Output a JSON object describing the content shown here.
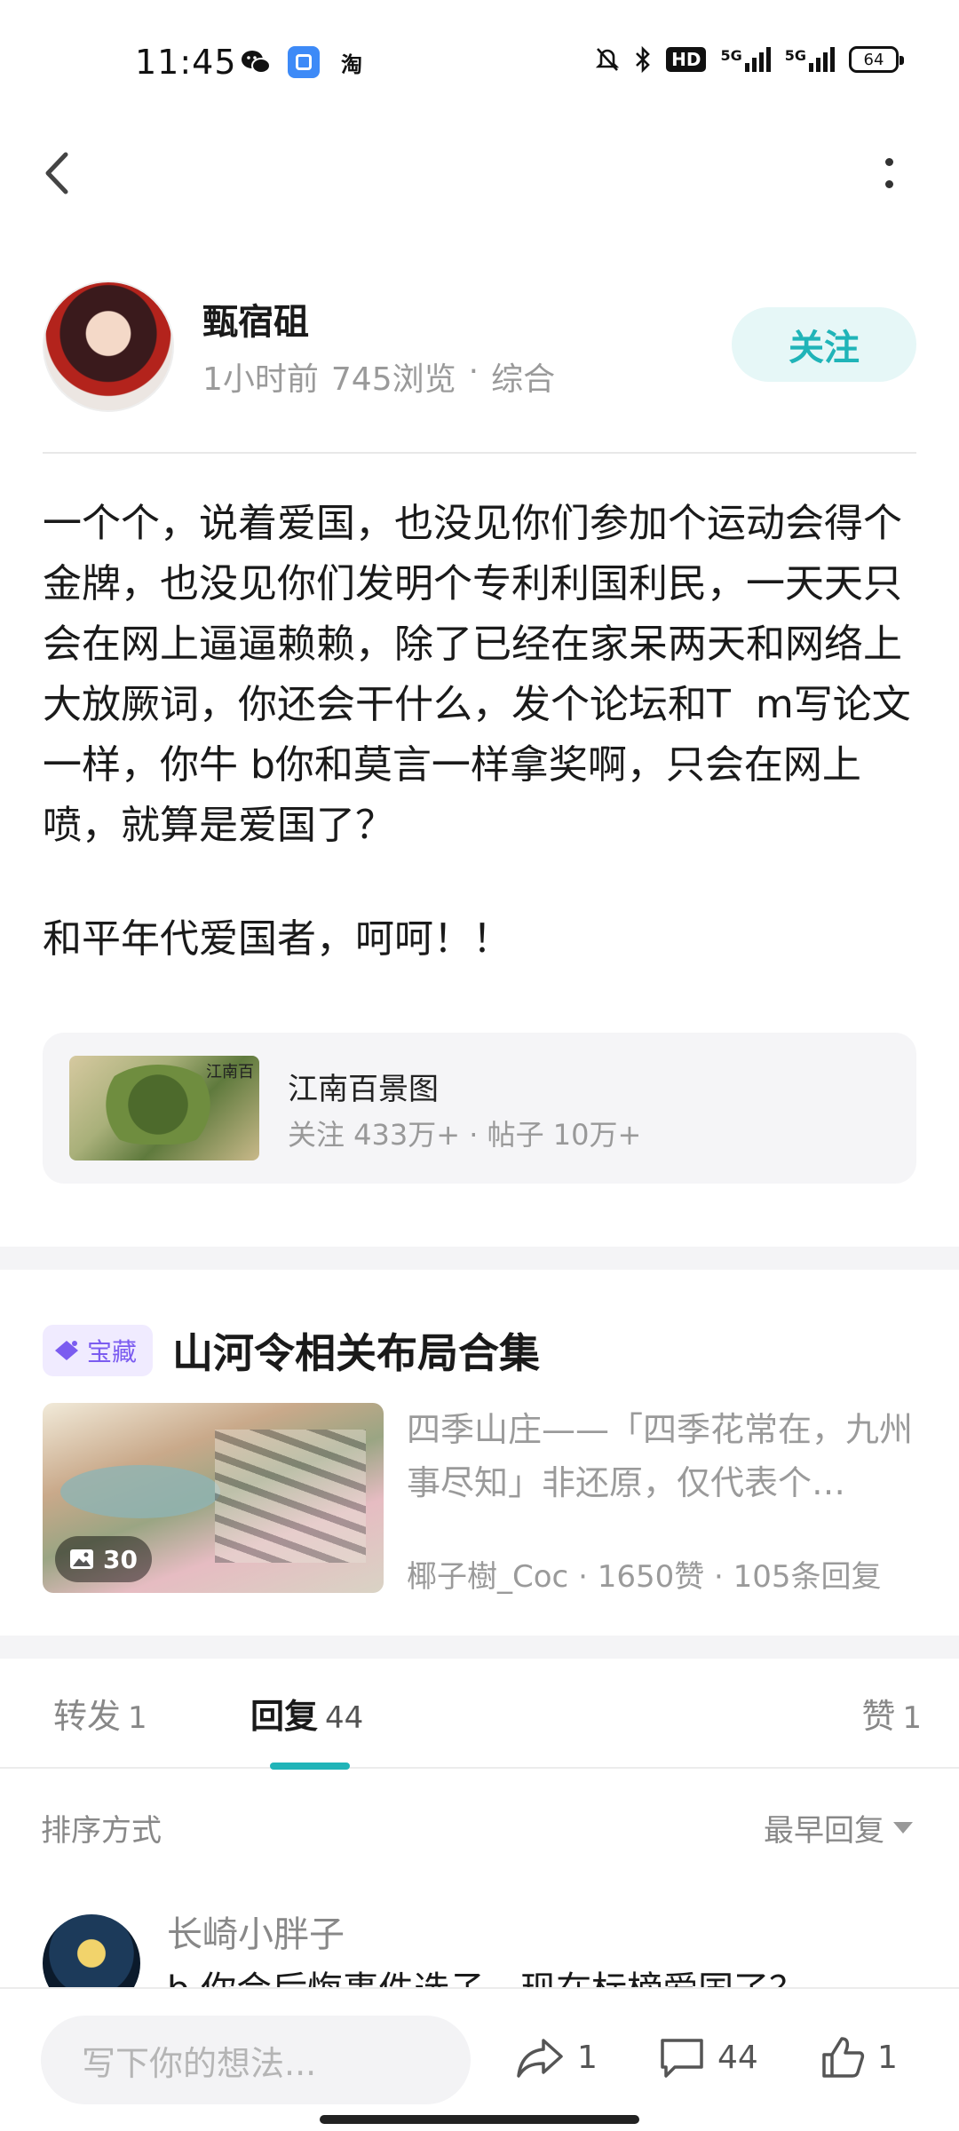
{
  "status_bar": {
    "time": "11:45",
    "network_1": "5G",
    "network_2": "5G",
    "hd_label": "HD",
    "battery": "64",
    "app_icons": [
      "wechat-icon",
      "app-square-icon",
      "taobao-icon"
    ],
    "status_icons": [
      "mute-bell-icon",
      "bluetooth-icon",
      "hd-icon",
      "signal-icon",
      "signal-icon",
      "battery-icon"
    ]
  },
  "author": {
    "name": "甄宿砠",
    "time": "1小时前",
    "views": "745浏览",
    "separator": "·",
    "category": "综合",
    "follow_label": "关注"
  },
  "post": {
    "paragraph_1": "一个个，说着爱国，也没见你们参加个运动会得个金牌，也没见你们发明个专利利国利民，一天天只会在网上逼逼赖赖，除了已经在家呆两天和网络上大放厥词，你还会干什么，发个论坛和T  m写论文一样，你牛 b你和莫言一样拿奖啊，只会在网上喷，就算是爱国了？",
    "paragraph_2": "和平年代爱国者，呵呵！！"
  },
  "forum": {
    "name": "江南百景图",
    "stats": "关注 433万+ · 帖子 10万+",
    "thumb_text": "江南百"
  },
  "collection": {
    "badge": "宝藏",
    "title": "山河令相关布局合集",
    "description": "四季山庄——「四季花常在，九州事尽知」非还原，仅代表个…",
    "image_count": "30",
    "author": "椰子樹_Coc",
    "likes": "1650赞",
    "replies": "105条回复",
    "separator": "·"
  },
  "tabs": {
    "forward_label": "转发",
    "forward_count": "1",
    "reply_label": "回复",
    "reply_count": "44",
    "like_label": "赞",
    "like_count": "1",
    "accent": "#20b4b8"
  },
  "sort": {
    "label": "排序方式",
    "value": "最早回复"
  },
  "comment": {
    "user": "长崎小胖子",
    "text": "b 你会后悔事件选子，现在标榜爱国了？"
  },
  "bottom_bar": {
    "placeholder": "写下你的想法...",
    "share_count": "1",
    "comment_count": "44",
    "like_count": "1"
  }
}
